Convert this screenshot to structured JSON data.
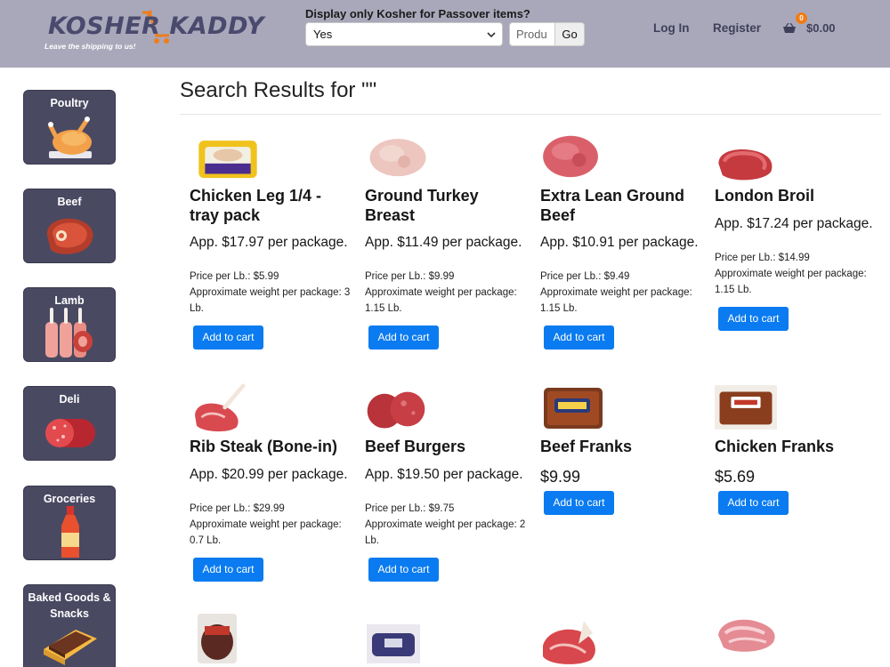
{
  "header": {
    "logo_word1": "KOSHER",
    "logo_word2": "KADDY",
    "logo_tagline": "Leave the shipping to us!",
    "passover_label": "Display only Kosher for Passover items?",
    "passover_value": "Yes",
    "search_placeholder": "Produ",
    "go_label": "Go",
    "login_label": "Log In",
    "register_label": "Register",
    "cart_count": "0",
    "cart_total": "$0.00"
  },
  "sidebar": {
    "items": [
      {
        "label": "Poultry"
      },
      {
        "label": "Beef"
      },
      {
        "label": "Lamb"
      },
      {
        "label": "Deli"
      },
      {
        "label": "Groceries"
      },
      {
        "label": "Baked Goods & Snacks"
      }
    ]
  },
  "main": {
    "title": "Search Results for \"\"",
    "products": [
      {
        "name": "Chicken Leg 1/4 - tray pack",
        "price": "App. $17.97 per package.",
        "per_lb": "Price per Lb.: $5.99",
        "weight": "Approximate weight per package: 3 Lb.",
        "cart": "Add to cart"
      },
      {
        "name": "Ground Turkey Breast",
        "price": "App. $11.49 per package.",
        "per_lb": "Price per Lb.: $9.99",
        "weight": "Approximate weight per package: 1.15 Lb.",
        "cart": "Add to cart"
      },
      {
        "name": "Extra Lean Ground Beef",
        "price": "App. $10.91 per package.",
        "per_lb": "Price per Lb.: $9.49",
        "weight": "Approximate weight per package: 1.15 Lb.",
        "cart": "Add to cart"
      },
      {
        "name": "London Broil",
        "price": "App. $17.24 per package.",
        "per_lb": "Price per Lb.: $14.99",
        "weight": "Approximate weight per package: 1.15 Lb.",
        "cart": "Add to cart"
      },
      {
        "name": "Rib Steak (Bone-in)",
        "price": "App. $20.99 per package.",
        "per_lb": "Price per Lb.: $29.99",
        "weight": "Approximate weight per package: 0.7 Lb.",
        "cart": "Add to cart"
      },
      {
        "name": "Beef Burgers",
        "price": "App. $19.50 per package.",
        "per_lb": "Price per Lb.: $9.75",
        "weight": "Approximate weight per package: 2 Lb.",
        "cart": "Add to cart"
      },
      {
        "name": "Beef Franks",
        "price": "$9.99",
        "cart": "Add to cart"
      },
      {
        "name": "Chicken Franks",
        "price": "$5.69",
        "cart": "Add to cart"
      }
    ]
  }
}
